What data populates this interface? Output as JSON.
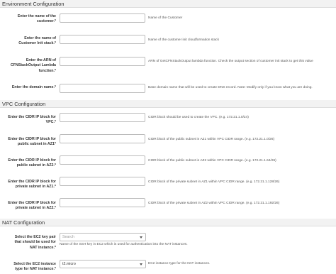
{
  "sections": {
    "environment": "Environment Configuration",
    "vpc": "VPC Configuration",
    "nat": "NAT Configuration"
  },
  "fields": {
    "customer": {
      "label_lines": [
        "Enter the name of the",
        "customer.*"
      ],
      "description": "Name of the Customer"
    },
    "stack": {
      "label_lines": [
        "Enter the name of",
        "Customer Init stack.*"
      ],
      "description": "Name of the customer init cloudformation stack"
    },
    "arn": {
      "label_lines": [
        "Enter the ARN of",
        "CFNStackOutput Lambda",
        "function.*"
      ],
      "description": "ARN of GetCFNStackOutput lambda function. Check the output section of customer init stack to get this value"
    },
    "domain": {
      "label_lines": [
        "Enter the domain name.*"
      ],
      "description": "Base domain name that will be used to create DNS record. Note: Modify only if you know what you are doing."
    },
    "vpc_cidr": {
      "label_lines": [
        "Enter the CIDR IP block for",
        "VPC.*"
      ],
      "description": "CIDR block should be used to create the VPC. (e.g. 172.21.1.0/24)"
    },
    "public_az1": {
      "label_lines": [
        "Enter the CIDR IP block for",
        "public subnet in AZ1*"
      ],
      "description": "CIDR block of the public subnet in AZ1 within VPC CIDR range. (e.g. 172.21.1.0/26)"
    },
    "public_az2": {
      "label_lines": [
        "Enter the CIDR IP block for",
        "public subnet in AZ2.*"
      ],
      "description": "CIDR block of the public subnet in AZ2 within VPC CIDR range. (e.g. 172.21.1.64/26)"
    },
    "private_az1": {
      "label_lines": [
        "Enter the CIDR IP block for",
        "private subnet in AZ1.*"
      ],
      "description": "CIDR block of the private subnet in AZ1 within VPC CIDR range. (e.g. 172.21.1.128/26)"
    },
    "private_az2": {
      "label_lines": [
        "Enter the CIDR IP block for",
        "private subnet in AZ2.*"
      ],
      "description": "CIDR block of the private subnet in AZ2 within VPC CIDR range. (e.g. 172.21.1.192/26)"
    },
    "key_pair": {
      "label_lines": [
        "Select the EC2 key pair",
        "that should be used for",
        "NAT instance.*"
      ],
      "placeholder": "Search",
      "description": "Name of the SSH key in EC2 which is used for authentication into the NAT instances."
    },
    "instance_type": {
      "label_lines": [
        "Select the EC2 instance",
        "type for NAT instance.*"
      ],
      "value": "t2.micro",
      "description": "EC2 instance type for the NAT instances."
    }
  }
}
